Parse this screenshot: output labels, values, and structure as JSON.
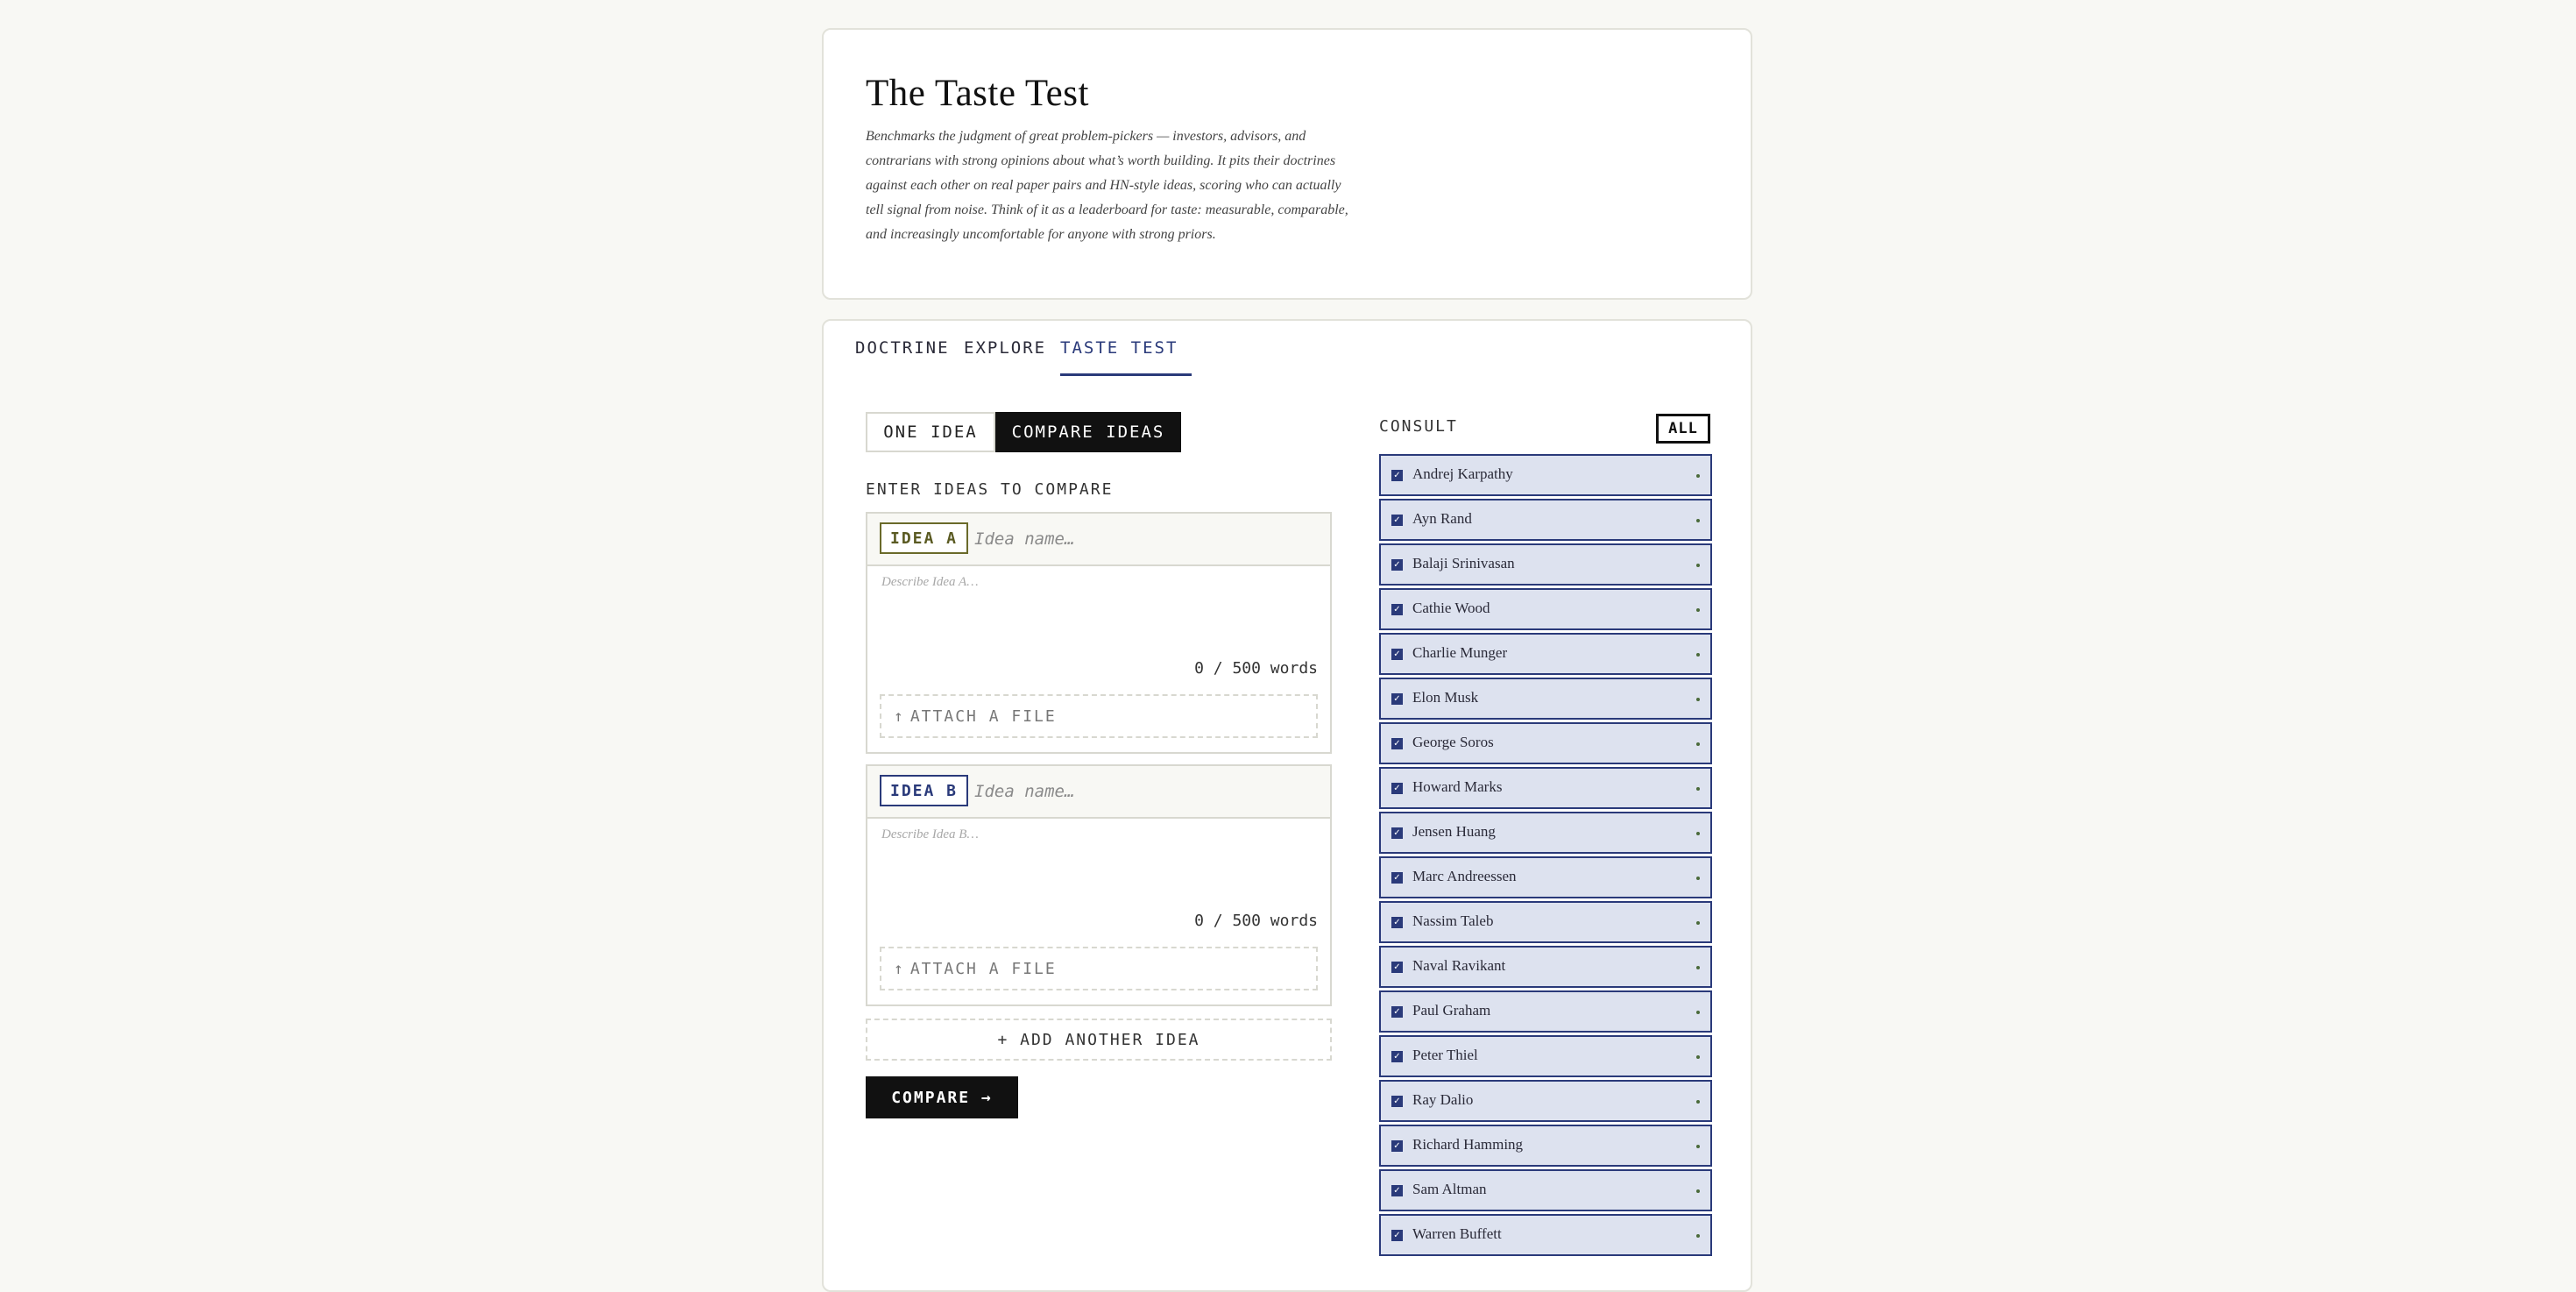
{
  "hero": {
    "title": "The Taste Test",
    "description": "Benchmarks the judgment of great problem-pickers — investors, advisors, and contrarians with strong opinions about what’s worth building. It pits their doctrines against each other on real paper pairs and HN-style ideas, scoring who can actually tell signal from noise. Think of it as a leaderboard for taste: measurable, comparable, and increasingly uncomfortable for anyone with strong priors."
  },
  "tabs": [
    {
      "label": "DOCTRINE"
    },
    {
      "label": "EXPLORE"
    },
    {
      "label": "TASTE TEST",
      "active": true
    }
  ],
  "mode": {
    "one_idea": "ONE IDEA",
    "compare_ideas": "COMPARE IDEAS",
    "selected": "COMPARE IDEAS"
  },
  "form": {
    "section_label": "ENTER IDEAS TO COMPARE",
    "ideas": [
      {
        "tag": "IDEA A",
        "name_placeholder": "Idea name…",
        "desc_placeholder": "Describe Idea A…",
        "word_count": "0 / 500 words",
        "attach_label": "ATTACH A FILE"
      },
      {
        "tag": "IDEA B",
        "name_placeholder": "Idea name…",
        "desc_placeholder": "Describe Idea B…",
        "word_count": "0 / 500 words",
        "attach_label": "ATTACH A FILE"
      }
    ],
    "add_idea_label": "+ ADD ANOTHER IDEA",
    "compare_label": "COMPARE →"
  },
  "consult": {
    "label": "CONSULT",
    "all_label": "ALL",
    "advisors": [
      {
        "name": "Andrej Karpathy",
        "checked": true
      },
      {
        "name": "Ayn Rand",
        "checked": true
      },
      {
        "name": "Balaji Srinivasan",
        "checked": true
      },
      {
        "name": "Cathie Wood",
        "checked": true
      },
      {
        "name": "Charlie Munger",
        "checked": true
      },
      {
        "name": "Elon Musk",
        "checked": true
      },
      {
        "name": "George Soros",
        "checked": true
      },
      {
        "name": "Howard Marks",
        "checked": true
      },
      {
        "name": "Jensen Huang",
        "checked": true
      },
      {
        "name": "Marc Andreessen",
        "checked": true
      },
      {
        "name": "Nassim Taleb",
        "checked": true
      },
      {
        "name": "Naval Ravikant",
        "checked": true
      },
      {
        "name": "Paul Graham",
        "checked": true
      },
      {
        "name": "Peter Thiel",
        "checked": true
      },
      {
        "name": "Ray Dalio",
        "checked": true
      },
      {
        "name": "Richard Hamming",
        "checked": true
      },
      {
        "name": "Sam Altman",
        "checked": true
      },
      {
        "name": "Warren Buffett",
        "checked": true
      }
    ]
  },
  "colors": {
    "accent": "#2a3a7a",
    "idea_a": "#5a5a22",
    "background": "#f8f8f4",
    "selected_row": "#dde2ef"
  },
  "icons": {
    "attach": "arrow-up-icon",
    "checkbox": "checkbox-checked-icon",
    "status": "status-dot-icon"
  }
}
